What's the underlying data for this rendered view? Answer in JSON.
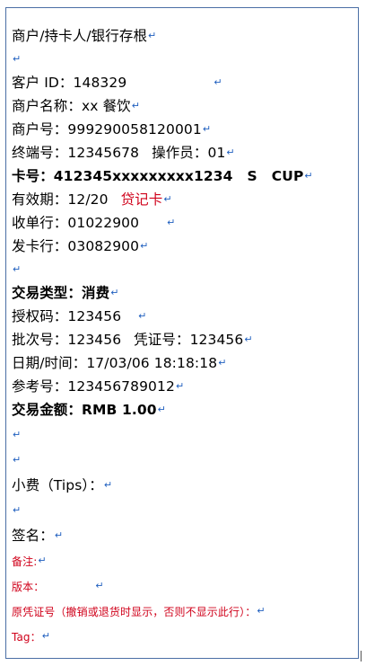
{
  "receipt": {
    "title": "商户/持卡人/银行存根",
    "merchant_id": "客户 ID：148329",
    "merchant_name": "商户名称：xx 餐饮",
    "merchant_no": "商户号：999290058120001",
    "terminal_no": "终端号：12345678",
    "operator": "操作员：01",
    "card_no": "卡号：412345xxxxxxxxx1234",
    "card_s": "S",
    "card_org": "CUP",
    "expiry": "有效期：12/20",
    "card_type": "贷记卡",
    "acquirer": "收单行：01022900",
    "issuer": "发卡行：03082900",
    "txn_type": "交易类型：消费",
    "auth_code": "授权码：123456",
    "batch_no": "批次号：123456",
    "voucher_no": "凭证号：123456",
    "datetime": "日期/时间：17/03/06 18:18:18",
    "ref_no": "参考号：123456789012",
    "amount": "交易金额：RMB 1.00",
    "tips": "小费（Tips）：",
    "signature": "签名：",
    "note": "备注:",
    "version": "版本：",
    "orig_voucher": "原凭证号（撤销或退货时显示，否则不显示此行）：",
    "tag": "Tag："
  },
  "paragraph_mark": "↵",
  "colors": {
    "border": "#4a6fa5",
    "mark": "#1f5fbf",
    "red_text": "#d0021b"
  }
}
